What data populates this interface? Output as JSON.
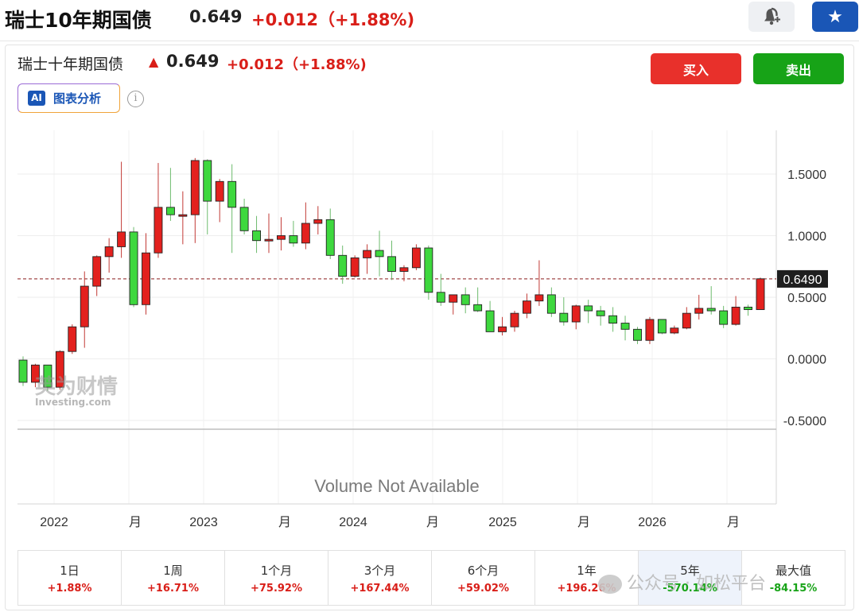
{
  "header": {
    "title": "瑞士10年期国债",
    "price": "0.649",
    "change": "+0.012（+1.88%)"
  },
  "sub_header": {
    "title": "瑞士十年期国债",
    "price": "0.649",
    "change": "+0.012（+1.88%)"
  },
  "actions": {
    "buy": "买入",
    "sell": "卖出",
    "ai": "图表分析",
    "ai_badge": "AI",
    "info": "i",
    "star": "★"
  },
  "colors": {
    "up": "#d91e18",
    "down": "#17a317",
    "candle_up": "#e3211e",
    "candle_down": "#3ed83e",
    "brand": "#1a56b6"
  },
  "watermarks": {
    "investing_cn": "英为财情",
    "investing": "Investing.com",
    "wechat": "公众号 · 如松平台"
  },
  "chart_data": {
    "type": "candlestick",
    "y_ticks": [
      "1.5000",
      "1.0000",
      "0.5000",
      "0.0000",
      "-0.5000"
    ],
    "ylim": [
      -0.5,
      1.75
    ],
    "x_ticks": [
      "2022",
      "月",
      "2023",
      "月",
      "2024",
      "月",
      "2025",
      "月",
      "2026",
      "月"
    ],
    "current_value_label": "0.6490",
    "current_value": 0.649,
    "volume_note": "Volume Not Available",
    "ohlc": [
      [
        -0.01,
        0.02,
        -0.22,
        -0.19
      ],
      [
        -0.19,
        -0.04,
        -0.23,
        -0.05
      ],
      [
        -0.05,
        -0.13,
        -0.26,
        -0.23
      ],
      [
        -0.23,
        0.07,
        -0.25,
        0.06
      ],
      [
        0.06,
        0.28,
        0.04,
        0.26
      ],
      [
        0.26,
        0.71,
        0.09,
        0.59
      ],
      [
        0.59,
        0.84,
        0.51,
        0.83
      ],
      [
        0.83,
        0.98,
        0.7,
        0.91
      ],
      [
        0.91,
        1.6,
        0.82,
        1.03
      ],
      [
        1.03,
        1.07,
        0.42,
        0.44
      ],
      [
        0.44,
        1.02,
        0.36,
        0.86
      ],
      [
        0.86,
        1.59,
        0.82,
        1.23
      ],
      [
        1.23,
        1.55,
        1.12,
        1.17
      ],
      [
        1.17,
        1.36,
        0.93,
        1.17
      ],
      [
        1.17,
        1.63,
        0.94,
        1.61
      ],
      [
        1.61,
        1.62,
        1.01,
        1.28
      ],
      [
        1.28,
        1.46,
        1.11,
        1.44
      ],
      [
        1.44,
        1.58,
        0.86,
        1.23
      ],
      [
        1.23,
        1.3,
        1.01,
        1.04
      ],
      [
        1.04,
        1.16,
        0.86,
        0.96
      ],
      [
        0.96,
        1.18,
        0.86,
        0.97
      ],
      [
        0.97,
        1.15,
        0.88,
        1.0
      ],
      [
        1.0,
        1.12,
        0.91,
        0.94
      ],
      [
        0.94,
        1.27,
        0.89,
        1.1
      ],
      [
        1.1,
        1.24,
        1.01,
        1.13
      ],
      [
        1.13,
        1.22,
        0.81,
        0.84
      ],
      [
        0.84,
        0.92,
        0.61,
        0.67
      ],
      [
        0.67,
        0.84,
        0.66,
        0.82
      ],
      [
        0.82,
        0.93,
        0.69,
        0.88
      ],
      [
        0.88,
        1.04,
        0.67,
        0.83
      ],
      [
        0.83,
        0.96,
        0.64,
        0.71
      ],
      [
        0.71,
        0.76,
        0.63,
        0.74
      ],
      [
        0.74,
        0.93,
        0.72,
        0.9
      ],
      [
        0.9,
        0.92,
        0.48,
        0.54
      ],
      [
        0.54,
        0.69,
        0.43,
        0.46
      ],
      [
        0.46,
        0.52,
        0.36,
        0.52
      ],
      [
        0.52,
        0.58,
        0.37,
        0.44
      ],
      [
        0.44,
        0.58,
        0.38,
        0.39
      ],
      [
        0.39,
        0.47,
        0.22,
        0.22
      ],
      [
        0.22,
        0.34,
        0.19,
        0.26
      ],
      [
        0.26,
        0.39,
        0.22,
        0.37
      ],
      [
        0.37,
        0.53,
        0.33,
        0.47
      ],
      [
        0.47,
        0.8,
        0.43,
        0.52
      ],
      [
        0.52,
        0.58,
        0.34,
        0.37
      ],
      [
        0.37,
        0.5,
        0.27,
        0.3
      ],
      [
        0.3,
        0.44,
        0.24,
        0.43
      ],
      [
        0.43,
        0.48,
        0.29,
        0.39
      ],
      [
        0.39,
        0.43,
        0.27,
        0.35
      ],
      [
        0.35,
        0.42,
        0.22,
        0.29
      ],
      [
        0.29,
        0.35,
        0.15,
        0.24
      ],
      [
        0.24,
        0.26,
        0.12,
        0.15
      ],
      [
        0.15,
        0.34,
        0.12,
        0.32
      ],
      [
        0.32,
        0.29,
        0.2,
        0.21
      ],
      [
        0.21,
        0.27,
        0.2,
        0.25
      ],
      [
        0.25,
        0.42,
        0.24,
        0.37
      ],
      [
        0.37,
        0.52,
        0.32,
        0.41
      ],
      [
        0.41,
        0.59,
        0.36,
        0.39
      ],
      [
        0.39,
        0.43,
        0.25,
        0.28
      ],
      [
        0.28,
        0.51,
        0.27,
        0.42
      ],
      [
        0.42,
        0.44,
        0.35,
        0.4
      ],
      [
        0.4,
        0.66,
        0.4,
        0.65
      ]
    ]
  },
  "ranges": [
    {
      "label": "1日",
      "value": "+1.88%",
      "dir": "up"
    },
    {
      "label": "1周",
      "value": "+16.71%",
      "dir": "up"
    },
    {
      "label": "1个月",
      "value": "+75.92%",
      "dir": "up"
    },
    {
      "label": "3个月",
      "value": "+167.44%",
      "dir": "up"
    },
    {
      "label": "6个月",
      "value": "+59.02%",
      "dir": "up"
    },
    {
      "label": "1年",
      "value": "+196.26%",
      "dir": "up"
    },
    {
      "label": "5年",
      "value": "-570.14%",
      "dir": "down"
    },
    {
      "label": "最大值",
      "value": "-84.15%",
      "dir": "down"
    }
  ]
}
